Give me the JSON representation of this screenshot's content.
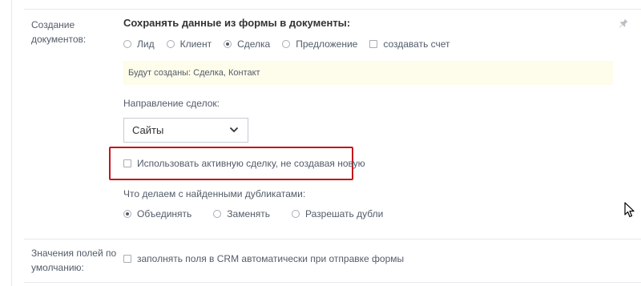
{
  "documents_row": {
    "label": "Создание документов:",
    "title": "Сохранять данные из формы в документы:",
    "options": [
      {
        "label": "Лид",
        "type": "radio",
        "checked": false
      },
      {
        "label": "Клиент",
        "type": "radio",
        "checked": false
      },
      {
        "label": "Сделка",
        "type": "radio",
        "checked": true
      },
      {
        "label": "Предложение",
        "type": "radio",
        "checked": false
      },
      {
        "label": "создавать счет",
        "type": "checkbox",
        "checked": false
      }
    ],
    "notice": "Будут созданы: Сделка, Контакт",
    "direction_label": "Направление сделок:",
    "direction_value": "Сайты",
    "active_deal_label": "Использовать активную сделку, не создавая новую",
    "active_deal_checked": false,
    "duplicates_label": "Что делаем с найденными дубликатами:",
    "duplicates_options": [
      {
        "label": "Объединять",
        "checked": true
      },
      {
        "label": "Заменять",
        "checked": false
      },
      {
        "label": "Разрешать дубли",
        "checked": false
      }
    ]
  },
  "defaults_row": {
    "label": "Значения полей по умолчанию:",
    "crm_autofill_label": "заполнять поля в CRM автоматически при отправке формы",
    "crm_autofill_checked": false
  },
  "icons": {
    "pin": "pin-icon",
    "chevron": "chevron-down-icon",
    "cursor": "mouse-cursor-icon"
  },
  "colors": {
    "highlight_border": "#c4161c",
    "notice_bg": "#fefcea",
    "text": "#535c69",
    "title": "#333333"
  }
}
